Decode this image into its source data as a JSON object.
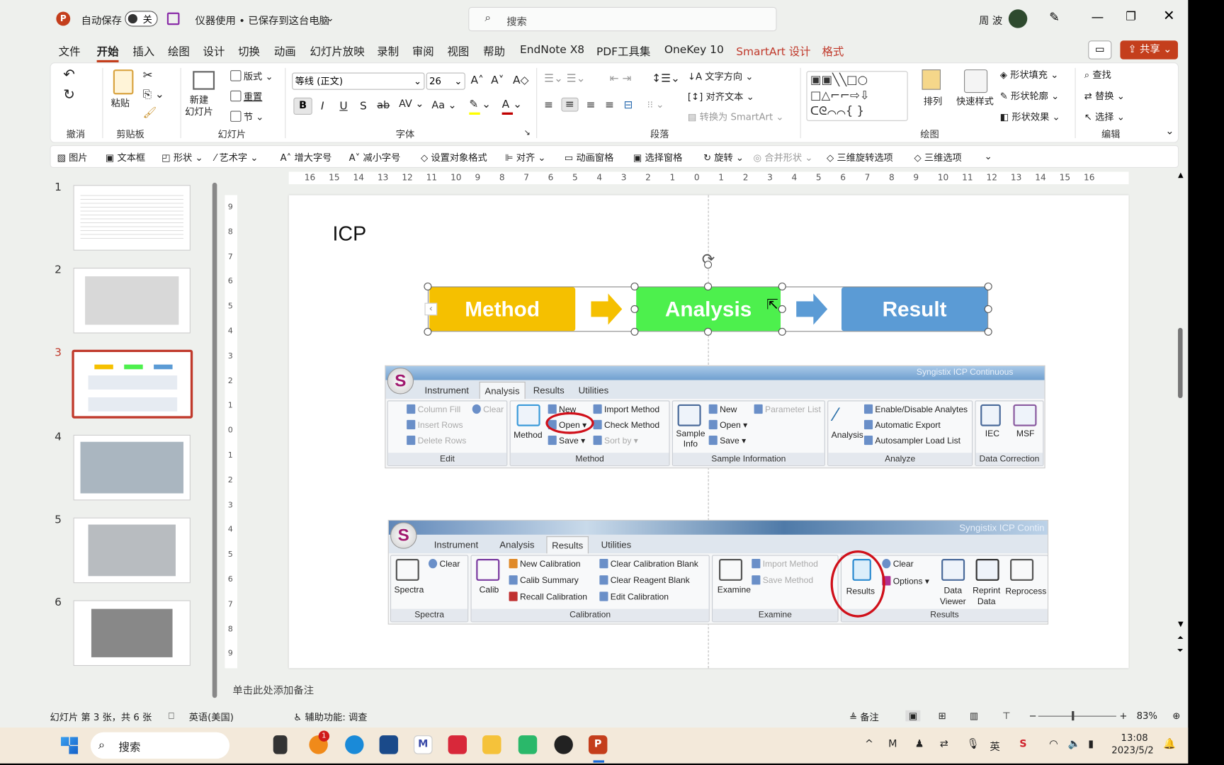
{
  "titlebar": {
    "autosave_label": "自动保存",
    "autosave_state": "关",
    "doc_title": "仪器使用 • 已保存到这台电脑",
    "search_placeholder": "搜索",
    "user": "周 波"
  },
  "menu": {
    "tabs": [
      "文件",
      "开始",
      "插入",
      "绘图",
      "设计",
      "切换",
      "动画",
      "幻灯片放映",
      "录制",
      "审阅",
      "视图",
      "帮助",
      "EndNote X8",
      "PDF工具集",
      "OneKey 10",
      "SmartArt 设计",
      "格式"
    ],
    "active": "开始",
    "comment_icon": "comment-icon",
    "share": "共享"
  },
  "ribbon": {
    "groups": [
      "撤消",
      "剪贴板",
      "幻灯片",
      "字体",
      "段落",
      "绘图",
      "编辑"
    ],
    "paste": "粘贴",
    "new_slide": "新建\n幻灯片",
    "layout": "版式",
    "reset": "重置",
    "section": "节",
    "font_name": "等线 (正文)",
    "font_size": "26",
    "text_direction": "文字方向",
    "align_text": "对齐文本",
    "convert_smartart": "转换为 SmartArt",
    "arrange": "排列",
    "quick_styles": "快速样式",
    "shape_fill": "形状填充",
    "shape_outline": "形状轮廓",
    "shape_effects": "形状效果",
    "find": "查找",
    "replace": "替换",
    "select": "选择",
    "font_color": "#c00000",
    "highlight_color": "#ffff00"
  },
  "quickbar": [
    "图片",
    "文本框",
    "形状",
    "艺术字",
    "增大字号",
    "减小字号",
    "设置对象格式",
    "对齐",
    "动画窗格",
    "选择窗格",
    "旋转",
    "合并形状",
    "三维旋转选项",
    "三维选项"
  ],
  "ruler": {
    "h_ticks": [
      "16",
      "15",
      "14",
      "13",
      "12",
      "11",
      "10",
      "9",
      "8",
      "7",
      "6",
      "5",
      "4",
      "3",
      "2",
      "1",
      "0",
      "1",
      "2",
      "3",
      "4",
      "5",
      "6",
      "7",
      "8",
      "9",
      "10",
      "11",
      "12",
      "13",
      "14",
      "15",
      "16"
    ],
    "v_ticks": [
      "9",
      "8",
      "7",
      "6",
      "5",
      "4",
      "3",
      "2",
      "1",
      "0",
      "1",
      "2",
      "3",
      "4",
      "5",
      "6",
      "7",
      "8",
      "9"
    ]
  },
  "thumbnails": [
    {
      "num": "1"
    },
    {
      "num": "2"
    },
    {
      "num": "3",
      "selected": true
    },
    {
      "num": "4"
    },
    {
      "num": "5"
    },
    {
      "num": "6"
    }
  ],
  "slide": {
    "title": "ICP",
    "flow": [
      {
        "label": "Method",
        "color": "#f5c000"
      },
      {
        "label": "Analysis",
        "color": "#4df04d"
      },
      {
        "label": "Result",
        "color": "#5b9bd5"
      }
    ],
    "arrow_colors": [
      "#f5c000",
      "#5b9bd5"
    ],
    "shot1": {
      "app_title": "Syngistix ICP Continuous",
      "tabs": [
        "Instrument",
        "Analysis",
        "Results",
        "Utilities"
      ],
      "active_tab": "Analysis",
      "edit": {
        "label": "Edit",
        "items": [
          "Column Fill",
          "Clear",
          "Insert Rows",
          "Delete Rows"
        ]
      },
      "method": {
        "label": "Method",
        "big": "Method",
        "items": [
          "New",
          "Import Method",
          "Open",
          "Check Method",
          "Save",
          "Sort by"
        ]
      },
      "sample": {
        "label": "Sample Information",
        "big": "Sample\nInfo",
        "items": [
          "New",
          "Parameter List",
          "Open",
          "Save"
        ]
      },
      "analyze": {
        "label": "Analyze",
        "big": "Analysis",
        "items": [
          "Enable/Disable Analytes",
          "Automatic Export",
          "Autosampler Load List"
        ]
      },
      "datacorr": {
        "label": "Data Correction",
        "items": [
          "IEC",
          "MSF"
        ]
      }
    },
    "shot2": {
      "app_title": "Syngistix ICP Contin",
      "tabs": [
        "Instrument",
        "Analysis",
        "Results",
        "Utilities"
      ],
      "active_tab": "Results",
      "spectra": {
        "label": "Spectra",
        "big": "Spectra",
        "items": [
          "Clear"
        ]
      },
      "calibration": {
        "label": "Calibration",
        "big": "Calib",
        "items": [
          "New Calibration",
          "Clear Calibration Blank",
          "Calib Summary",
          "Clear Reagent Blank",
          "Recall Calibration",
          "Edit Calibration"
        ]
      },
      "examine": {
        "label": "Examine",
        "big": "Examine",
        "items": [
          "Import Method",
          "Save Method"
        ]
      },
      "results": {
        "label": "Results",
        "items": [
          "Results",
          "Clear",
          "Options",
          "Data\nViewer",
          "Reprint\nData",
          "Reprocess"
        ]
      }
    }
  },
  "notes_placeholder": "单击此处添加备注",
  "status": {
    "slide_info": "幻灯片 第 3 张，共 6 张",
    "language": "英语(美国)",
    "accessibility": "辅助功能: 调查",
    "notes": "备注",
    "zoom": "83%",
    "zoom_level": 83
  },
  "taskbar": {
    "search": "搜索",
    "time": "13:08",
    "date": "2023/5/2",
    "badge": "1",
    "lang": "英"
  }
}
